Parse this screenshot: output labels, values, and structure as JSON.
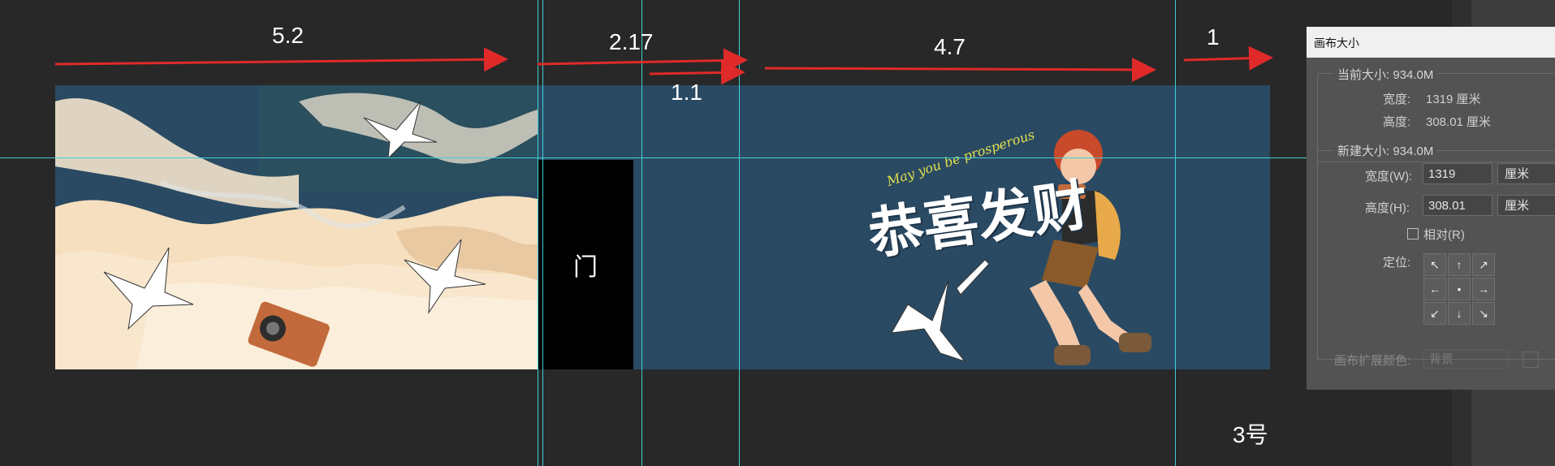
{
  "measurements": [
    "5.2",
    "2.17",
    "1.1",
    "4.7",
    "1"
  ],
  "canvas": {
    "door_label": "门",
    "number_label": "3号",
    "art_title": "恭喜发财",
    "art_script": "May you be prosperous"
  },
  "colors": {
    "workspace": "#282828",
    "canvas_bg": "#2a4a63",
    "guides": "#3fd0d6",
    "arrows": "#e02a2a"
  },
  "dialog": {
    "title": "画布大小",
    "current_size": {
      "legend": "当前大小: 934.0M",
      "width_label": "宽度:",
      "width_value": "1319 厘米",
      "height_label": "高度:",
      "height_value": "308.01 厘米"
    },
    "new_size": {
      "legend": "新建大小: 934.0M",
      "width_label": "宽度(W):",
      "width_value": "1319",
      "width_unit": "厘米",
      "height_label": "高度(H):",
      "height_value": "308.01",
      "height_unit": "厘米",
      "relative_label": "相对(R)",
      "relative_checked": false,
      "anchor_label": "定位:",
      "anchor_arrows": [
        "↖",
        "↑",
        "↗",
        "←",
        "•",
        "→",
        "↙",
        "↓",
        "↘"
      ]
    },
    "extension_color_label": "画布扩展颜色:",
    "extension_color_value": "背景"
  }
}
